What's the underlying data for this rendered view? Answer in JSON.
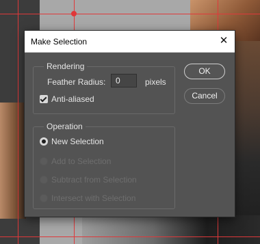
{
  "dialog": {
    "title": "Make Selection",
    "close_glyph": "✕"
  },
  "rendering": {
    "legend": "Rendering",
    "feather_label": "Feather Radius:",
    "feather_value": "0",
    "feather_unit": "pixels",
    "anti_aliased_label": "Anti-aliased",
    "anti_aliased_checked": true
  },
  "operation": {
    "legend": "Operation",
    "options": [
      {
        "label": "New Selection",
        "selected": true,
        "enabled": true
      },
      {
        "label": "Add to Selection",
        "selected": false,
        "enabled": false
      },
      {
        "label": "Subtract from Selection",
        "selected": false,
        "enabled": false
      },
      {
        "label": "Intersect with Selection",
        "selected": false,
        "enabled": false
      }
    ]
  },
  "buttons": {
    "ok": "OK",
    "cancel": "Cancel"
  },
  "colors": {
    "dialog_bg": "#535353",
    "selection_line": "#e0383a"
  }
}
